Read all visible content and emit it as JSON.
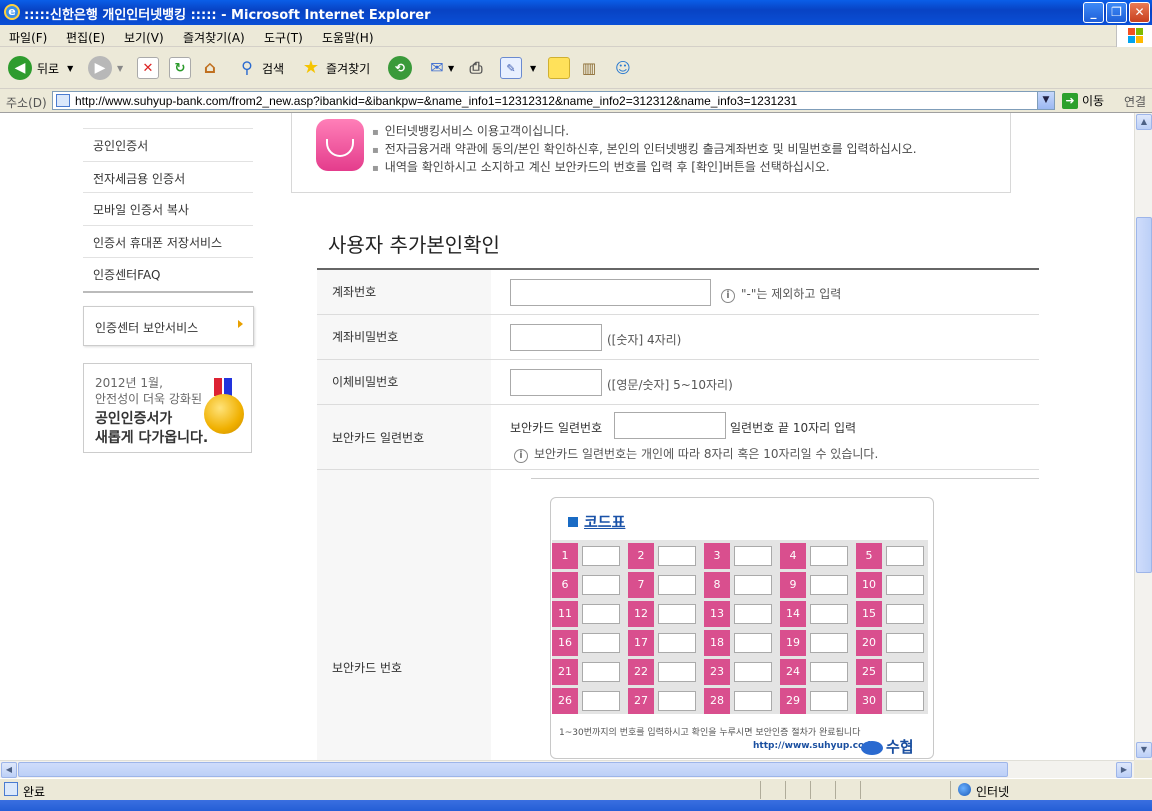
{
  "window": {
    "title": ":::::신한은행 개인인터넷뱅킹 ::::: - Microsoft Internet Explorer",
    "btn_min": "_",
    "btn_max": "❐",
    "btn_close": "✕"
  },
  "menu": [
    "파일(F)",
    "편집(E)",
    "보기(V)",
    "즐겨찾기(A)",
    "도구(T)",
    "도움말(H)"
  ],
  "toolbar": {
    "back": "뒤로",
    "search": "검색",
    "favorites": "즐겨찾기"
  },
  "address": {
    "label": "주소(D)",
    "url": "http://www.suhyup-bank.com/from2_new.asp?ibankid=&ibankpw=&name_info1=12312312&name_info2=312312&name_info3=1231231",
    "go": "이동",
    "links": "연결"
  },
  "sidebar": {
    "items": [
      "공인인증서",
      "전자세금용 인증서",
      "모바일 인증서 복사",
      "인증서 휴대폰 저장서비스",
      "인증센터FAQ"
    ],
    "security": "인증센터 보안서비스",
    "banner": [
      "2012년 1월,",
      "안전성이 더욱 강화된",
      "공인인증서가",
      "새롭게 다가옵니다."
    ]
  },
  "notice": [
    "인터넷뱅킹서비스 이용고객이십니다.",
    "전자금융거래 약관에 동의/본인 확인하신후, 본인의 인터넷뱅킹 출금계좌번호 및 비밀번호를 입력하십시오.",
    "내역을 확인하시고 소지하고 계신 보안카드의 번호를 입력 후 [확인]버튼을 선택하십시오."
  ],
  "page_title": "사용자 추가본인확인",
  "form": {
    "account": {
      "label": "계좌번호",
      "hint": "\"-\"는 제외하고 입력",
      "value": ""
    },
    "account_pw": {
      "label": "계좌비밀번호",
      "hint": "([숫자] 4자리)",
      "value": ""
    },
    "transfer_pw": {
      "label": "이체비밀번호",
      "hint": "([영문/숫자] 5~10자리)",
      "value": ""
    },
    "card_serial": {
      "label": "보안카드 일련번호",
      "prefix": "보안카드 일련번호",
      "suffix": "일련번호 끝 10자리 입력",
      "note": "보안카드 일련번호는 개인에 따라 8자리 혹은 10자리일 수 있습니다.",
      "value": ""
    },
    "card_number": {
      "label": "보안카드 번호"
    }
  },
  "code_table": {
    "title": "코드표",
    "numbers": [
      "1",
      "2",
      "3",
      "4",
      "5",
      "6",
      "7",
      "8",
      "9",
      "10",
      "11",
      "12",
      "13",
      "14",
      "15",
      "16",
      "17",
      "18",
      "19",
      "20",
      "21",
      "22",
      "23",
      "24",
      "25",
      "26",
      "27",
      "28",
      "29",
      "30"
    ],
    "footer": "1~30번까지의 번호를 입력하시고 확인을 누루시면 보안인증 절차가 완료됩니다",
    "url": "http://www.suhyup.co.kr",
    "logo": "수협"
  },
  "status": {
    "text": "완료",
    "zone": "인터넷"
  },
  "colors": {
    "title_bar": "#0a4fd6",
    "code_cell": "#d94f8e",
    "code_title": "#1a52a8"
  }
}
